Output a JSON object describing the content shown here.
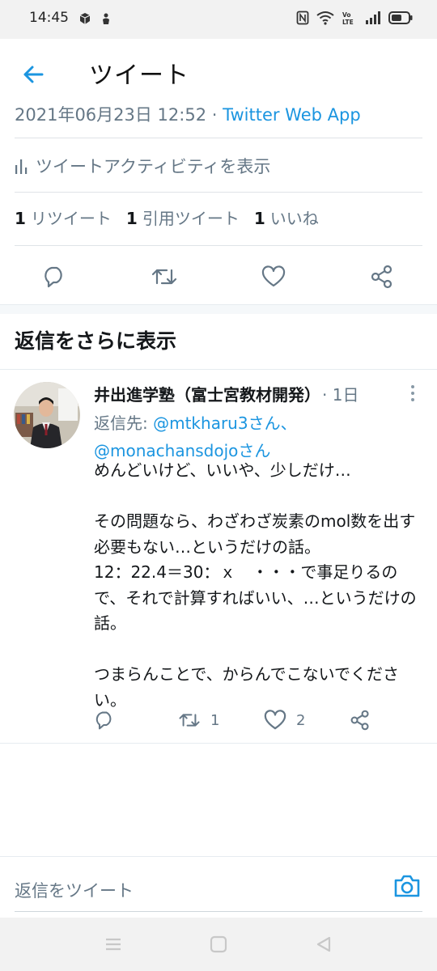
{
  "status_bar": {
    "time": "14:45",
    "left_icons": [
      "cube-notification-icon",
      "app-notification-icon"
    ],
    "right_icons": [
      "nfc-icon",
      "wifi-icon",
      "volte-icon",
      "signal-icon",
      "battery-icon"
    ]
  },
  "app_bar": {
    "title": "ツイート",
    "back_icon": "arrow-left-icon"
  },
  "tweet_meta": {
    "timestamp": "2021年06月23日 12:52",
    "separator": " · ",
    "client": "Twitter Web App"
  },
  "activity": {
    "label": "ツイートアクティビティを表示",
    "icon": "bar-chart-icon"
  },
  "stats": [
    {
      "count": "1",
      "label": "リツイート"
    },
    {
      "count": "1",
      "label": "引用ツイート"
    },
    {
      "count": "1",
      "label": "いいね"
    }
  ],
  "actions": [
    "reply-icon",
    "retweet-icon",
    "like-icon",
    "share-icon"
  ],
  "more_replies_label": "返信をさらに表示",
  "reply": {
    "author": "井出進学塾（富士宮教材開発）",
    "time": "· 1日",
    "reply_to_prefix": "返信先: ",
    "mention_1": "@mtkharu3さん、",
    "mention_2": "@monachansdojoさん",
    "body": "めんどいけど、いいや、少しだけ…\n\nその問題なら、わざわざ炭素のmol数を出す必要もない…というだけの話。\n12：22.4＝30：ｘ　・・・で事足りるので、それで計算すればいい、…というだけの話。\n\nつまらんことで、からんでこないでください。",
    "retweet_count": "1",
    "like_count": "2"
  },
  "compose": {
    "placeholder": "返信をツイート",
    "icon": "camera-icon"
  },
  "colors": {
    "accent": "#1b95e0",
    "secondary_text": "#657786",
    "primary_text": "#14171a",
    "divider": "#e6ecf0"
  }
}
